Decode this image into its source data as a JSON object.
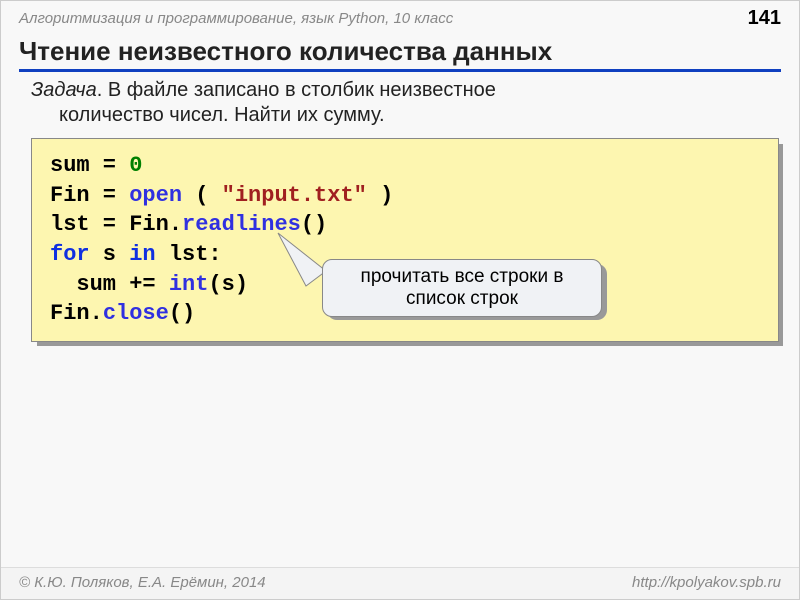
{
  "header": {
    "course": "Алгоритмизация и программирование, язык Python, 10 класс",
    "page": "141"
  },
  "title": "Чтение неизвестного количества данных",
  "task": {
    "label": "Задача",
    "line1": ". В файле записано в столбик неизвестное",
    "line2": "количество чисел. Найти их сумму."
  },
  "code": {
    "l1a": "sum",
    "l1b": " = ",
    "l1c": "0",
    "l2a": "Fin",
    "l2b": " = ",
    "l2c": "open",
    "l2d": " ( ",
    "l2e": "\"input.txt\"",
    "l2f": " )",
    "l3a": "lst",
    "l3b": " = ",
    "l3c": "Fin.",
    "l3d": "readlines",
    "l3e": "()",
    "l4a": "for",
    "l4b": " s ",
    "l4c": "in",
    "l4d": " lst:",
    "l5a": "  sum",
    "l5b": " += ",
    "l5c": "int",
    "l5d": "(s)",
    "l6a": "Fin.",
    "l6b": "close",
    "l6c": "()"
  },
  "callout": {
    "line1": "прочитать все строки в",
    "line2": "список строк"
  },
  "footer": {
    "left": "© К.Ю. Поляков, Е.А. Ерёмин, 2014",
    "right": "http://kpolyakov.spb.ru"
  }
}
